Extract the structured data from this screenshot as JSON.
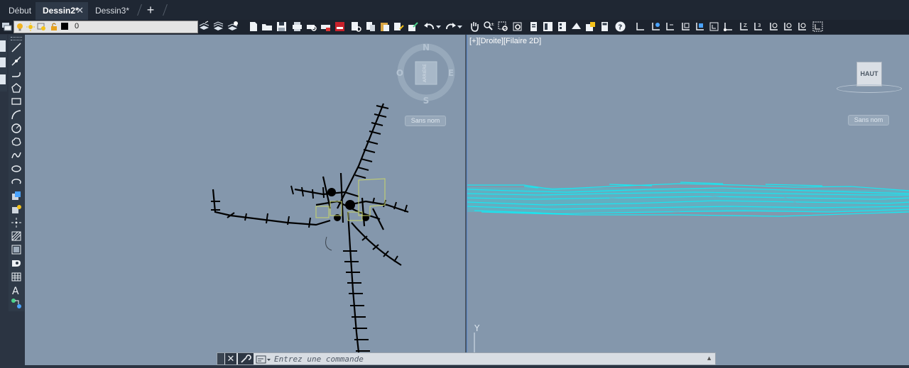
{
  "tabs": [
    {
      "label": "Début",
      "active": false
    },
    {
      "label": "Dessin2*",
      "active": true,
      "closable": true
    },
    {
      "label": "Dessin3*",
      "active": false
    }
  ],
  "tab_close_glyph": "✕",
  "tab_add_glyph": "+",
  "layer_combo": {
    "value": "0",
    "icons": [
      "bulb-on-icon",
      "sun-icon",
      "freeze-viewport-icon",
      "lock-icon",
      "color-swatch-icon"
    ],
    "swatch_color": "#000000"
  },
  "viewports": {
    "left": {
      "compass": {
        "north": "N",
        "south": "S",
        "east": "E",
        "west": "O",
        "center": "ARRIÈRE"
      },
      "unnamed_label": "Sans nom"
    },
    "right": {
      "label": "[+][Droite][Filaire 2D]",
      "viewcube": "HAUT",
      "unnamed_label": "Sans nom",
      "ucs_axis": "Y"
    }
  },
  "colors": {
    "viewport_bg": "#8497ac",
    "geometry_cyan": "#19e6f0",
    "geometry_black": "#000000",
    "parcel_yellow": "#c8d46a",
    "tabbar_bg": "#1f2733",
    "ribbon_bg": "#1c232e"
  },
  "command_line": {
    "placeholder": "Entrez une commande",
    "close_glyph": "✕"
  }
}
